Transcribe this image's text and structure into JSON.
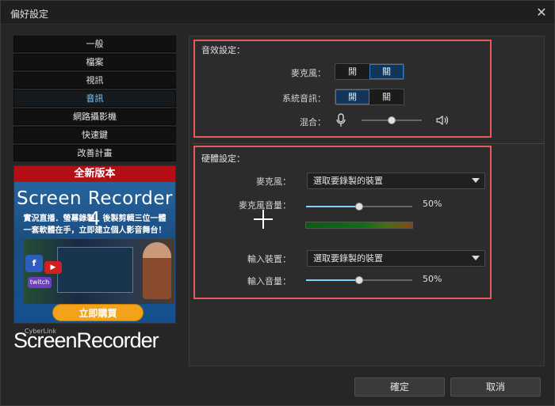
{
  "window": {
    "title": "偏好設定",
    "close_icon": "close-icon"
  },
  "sidebar": {
    "items": [
      {
        "label": "一般"
      },
      {
        "label": "檔案"
      },
      {
        "label": "視訊"
      },
      {
        "label": "音訊"
      },
      {
        "label": "網路攝影機"
      },
      {
        "label": "快速鍵"
      },
      {
        "label": "改善計畫"
      }
    ],
    "active_index": 3
  },
  "banner": {
    "top": "全新版本",
    "title": "Screen Recorder 4",
    "line1": "實況直播．螢幕錄製．後製剪輯三位一體",
    "line2": "一套軟體在手，立即建立個人影音舞台！",
    "cta": "立即購買",
    "icons": [
      "facebook-icon",
      "youtube-icon",
      "twitch-icon"
    ]
  },
  "brand": {
    "small": "CyberLink",
    "name": "ScreenRecorder"
  },
  "audio_settings": {
    "title": "音效設定：",
    "mic_label": "麥克風：",
    "system_label": "系統音訊：",
    "mix_label": "混合：",
    "mic_toggle": {
      "on": "開",
      "off": "關"
    },
    "system_toggle": {
      "on": "開",
      "off": "關"
    },
    "mix_level": 0.5,
    "mic_icon": "microphone-icon",
    "speaker_icon": "speaker-icon"
  },
  "hardware_settings": {
    "title": "硬體設定：",
    "mic_label": "麥克風：",
    "mic_select": "選取要錄製的裝置",
    "mic_volume_label": "麥克風音量：",
    "mic_volume": "50%",
    "input_device_label": "輸入裝置：",
    "input_select": "選取要錄製的裝置",
    "input_volume_label": "輸入音量：",
    "input_volume": "50%"
  },
  "footer": {
    "ok": "確定",
    "cancel": "取消"
  },
  "colors": {
    "accent": "#8fd0ff",
    "highlight_frame": "#e35b5b",
    "button": "#3a3a3a"
  }
}
